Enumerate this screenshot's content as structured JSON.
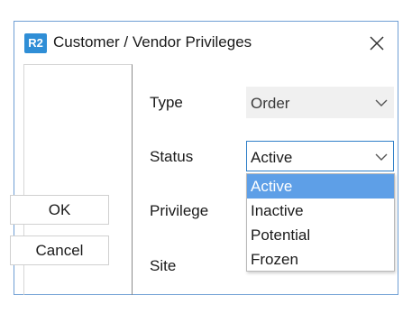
{
  "dialog": {
    "icon_text": "R2",
    "title": "Customer / Vendor Privileges"
  },
  "buttons": {
    "ok": "OK",
    "cancel": "Cancel"
  },
  "fields": {
    "type": {
      "label": "Type",
      "value": "Order"
    },
    "status": {
      "label": "Status",
      "value": "Active"
    },
    "privilege": {
      "label": "Privilege"
    },
    "site": {
      "label": "Site"
    }
  },
  "status_dropdown": {
    "options": [
      "Active",
      "Inactive",
      "Potential",
      "Frozen"
    ],
    "selected": "Active"
  },
  "colors": {
    "accent": "#2f8ed6",
    "focus_border": "#2f7fc8",
    "selection": "#5e9fe7",
    "dialog_border": "#6f9fd4"
  }
}
